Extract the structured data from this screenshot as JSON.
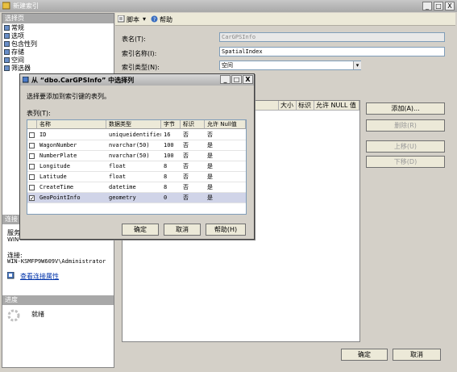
{
  "window": {
    "title": "新建索引",
    "min": "_",
    "max": "□",
    "close": "X"
  },
  "left": {
    "select_page_header": "选择页",
    "nav": [
      "常规",
      "选项",
      "包含性列",
      "存储",
      "空间",
      "筛选器"
    ],
    "connection_header": "连接",
    "server_label": "服务",
    "server_value": "WIN-",
    "connection_label": "连接:",
    "connection_value": "WIN-KSMFP9W609V\\Administrator",
    "view_props_link": "查看连接属性",
    "progress_header": "进度",
    "progress_status": "就绪"
  },
  "toolbar": {
    "script_label": "脚本",
    "help_label": "帮助"
  },
  "form": {
    "table_name_label": "表名(T):",
    "table_name_value": "CarGPSInfo",
    "index_name_label": "索引名称(I):",
    "index_name_value": "SpatialIndex",
    "index_type_label": "索引类型(N):",
    "index_type_value": "空间"
  },
  "index_grid": {
    "headers": [
      "大小",
      "标识",
      "允许 NULL 值"
    ]
  },
  "buttons": {
    "add": "添加(A)...",
    "remove": "删除(R)",
    "move_up": "上移(U)",
    "move_down": "下移(D)",
    "ok": "确定",
    "cancel": "取消"
  },
  "dialog": {
    "title": "从 “dbo.CarGPSInfo” 中选择列",
    "min": "_",
    "max": "□",
    "close": "X",
    "instruction": "选择要添加到索引键的表列。",
    "table_columns_label": "表列(T):",
    "headers": [
      "名称",
      "数据类型",
      "字节",
      "标识",
      "允许 Null值"
    ],
    "rows": [
      {
        "name": "ID",
        "type": "uniqueidentifier",
        "bytes": "16",
        "identity": "否",
        "nullable": "否",
        "checked": ""
      },
      {
        "name": "WagonNumber",
        "type": "nvarchar(50)",
        "bytes": "100",
        "identity": "否",
        "nullable": "是",
        "checked": ""
      },
      {
        "name": "NumberPlate",
        "type": "nvarchar(50)",
        "bytes": "100",
        "identity": "否",
        "nullable": "是",
        "checked": ""
      },
      {
        "name": "Longitude",
        "type": "float",
        "bytes": "8",
        "identity": "否",
        "nullable": "是",
        "checked": ""
      },
      {
        "name": "Latitude",
        "type": "float",
        "bytes": "8",
        "identity": "否",
        "nullable": "是",
        "checked": ""
      },
      {
        "name": "CreateTime",
        "type": "datetime",
        "bytes": "8",
        "identity": "否",
        "nullable": "是",
        "checked": ""
      },
      {
        "name": "GeoPointInfo",
        "type": "geometry",
        "bytes": "0",
        "identity": "否",
        "nullable": "是",
        "checked": "✓"
      }
    ],
    "ok": "确定",
    "cancel": "取消",
    "help": "帮助(H)"
  }
}
